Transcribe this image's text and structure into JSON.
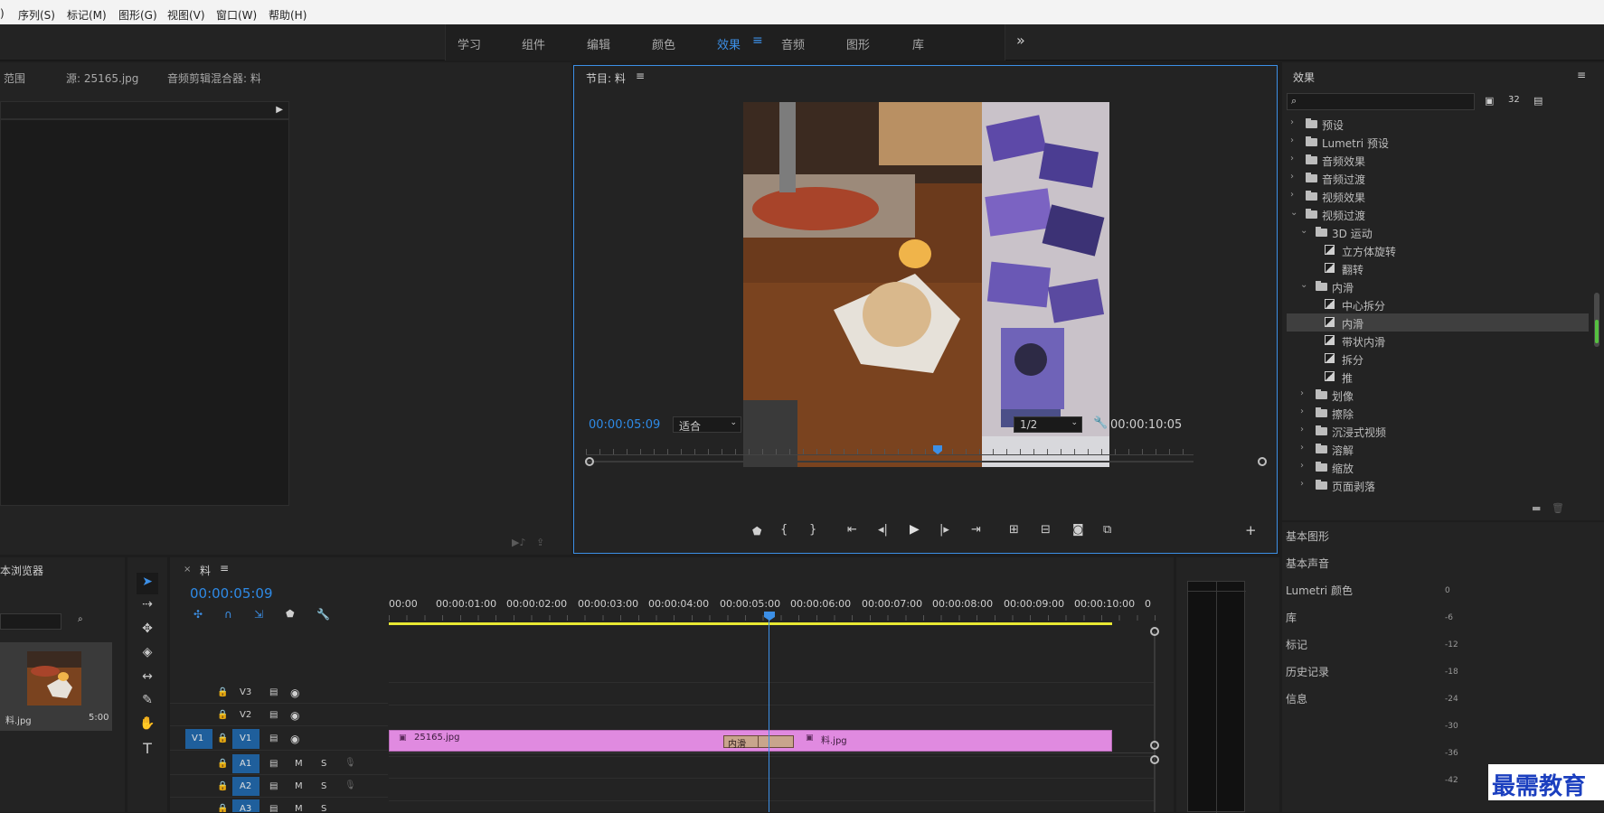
{
  "menu": [
    "序列(S)",
    "标记(M)",
    "图形(G)",
    "视图(V)",
    "窗口(W)",
    "帮助(H)"
  ],
  "workspaces": {
    "tabs": [
      "学习",
      "组件",
      "编辑",
      "颜色",
      "效果",
      "音频",
      "图形",
      "库"
    ],
    "active": "效果",
    "more": "»"
  },
  "source_panel": {
    "tabs": [
      "范围",
      "源: 25165.jpg",
      "音频剪辑混合器: 料"
    ]
  },
  "program_monitor": {
    "title": "节目: 料",
    "timecode": "00:00:05:09",
    "fit": "适合",
    "resolution": "1/2",
    "duration": "00:00:10:05"
  },
  "effects_panel": {
    "title": "效果",
    "search_placeholder": "",
    "tree": [
      {
        "label": "预设",
        "type": "folder-special",
        "indent": 0,
        "expanded": false
      },
      {
        "label": "Lumetri 预设",
        "type": "folder-special",
        "indent": 0,
        "expanded": false
      },
      {
        "label": "音频效果",
        "type": "folder",
        "indent": 0,
        "expanded": false
      },
      {
        "label": "音频过渡",
        "type": "folder",
        "indent": 0,
        "expanded": false
      },
      {
        "label": "视频效果",
        "type": "folder",
        "indent": 0,
        "expanded": false
      },
      {
        "label": "视频过渡",
        "type": "folder",
        "indent": 0,
        "expanded": true
      },
      {
        "label": "3D 运动",
        "type": "folder",
        "indent": 1,
        "expanded": true
      },
      {
        "label": "立方体旋转",
        "type": "effect",
        "indent": 2
      },
      {
        "label": "翻转",
        "type": "effect",
        "indent": 2
      },
      {
        "label": "内滑",
        "type": "folder",
        "indent": 1,
        "expanded": true
      },
      {
        "label": "中心拆分",
        "type": "effect",
        "indent": 2
      },
      {
        "label": "内滑",
        "type": "effect",
        "indent": 2,
        "selected": true
      },
      {
        "label": "带状内滑",
        "type": "effect",
        "indent": 2
      },
      {
        "label": "拆分",
        "type": "effect",
        "indent": 2
      },
      {
        "label": "推",
        "type": "effect",
        "indent": 2
      },
      {
        "label": "划像",
        "type": "folder",
        "indent": 1,
        "expanded": false
      },
      {
        "label": "擦除",
        "type": "folder",
        "indent": 1,
        "expanded": false
      },
      {
        "label": "沉浸式视频",
        "type": "folder",
        "indent": 1,
        "expanded": false
      },
      {
        "label": "溶解",
        "type": "folder",
        "indent": 1,
        "expanded": false
      },
      {
        "label": "缩放",
        "type": "folder",
        "indent": 1,
        "expanded": false
      },
      {
        "label": "页面剥落",
        "type": "folder",
        "indent": 1,
        "expanded": false
      }
    ]
  },
  "right_panels": [
    "基本图形",
    "基本声音",
    "Lumetri 颜色",
    "库",
    "标记",
    "历史记录",
    "信息"
  ],
  "media_browser": {
    "title": "本浏览器",
    "clip_name": "料.jpg",
    "clip_duration": "5:00"
  },
  "timeline": {
    "tab": "料",
    "timecode": "00:00:05:09",
    "ruler": [
      "00:00",
      "00:00:01:00",
      "00:00:02:00",
      "00:00:03:00",
      "00:00:04:00",
      "00:00:05:00",
      "00:00:06:00",
      "00:00:07:00",
      "00:00:08:00",
      "00:00:09:00",
      "00:00:10:00",
      "0"
    ],
    "tracks": [
      "V3",
      "V2",
      "V1",
      "A1",
      "A2",
      "A3"
    ],
    "source_patch": "V1",
    "clip_a": "25165.jpg",
    "clip_b": "料.jpg",
    "transition": "内滑"
  },
  "meter_labels": [
    "0",
    "-6",
    "-12",
    "-18",
    "-24",
    "-30",
    "-36",
    "-42"
  ],
  "watermark": "最需教育",
  "colors": {
    "accent": "#2e8ae6",
    "clip": "#e08ae0",
    "transition": "#c8a58c",
    "playhead": "#3c8fe6",
    "workarea": "#e8e833"
  }
}
